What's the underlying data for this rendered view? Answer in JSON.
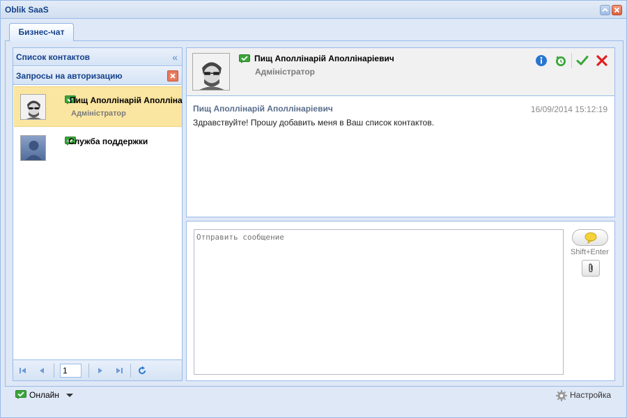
{
  "window": {
    "title": "Oblik SaaS"
  },
  "tabs": [
    {
      "label": "Бизнес-чат"
    }
  ],
  "sidebar": {
    "contacts_header": "Список контактов",
    "requests_header": "Запросы на авторизацию",
    "contacts": [
      {
        "name": "Пищ Аполлінарій Аполлінаріевич",
        "role": "Адміністратор",
        "selected": true
      },
      {
        "name": "Служба поддержки",
        "role": "",
        "selected": false
      }
    ],
    "pager": {
      "page": "1"
    }
  },
  "chat": {
    "header": {
      "name": "Пищ Аполлінарій Аполлінаріевич",
      "role": "Адміністратор"
    },
    "messages": [
      {
        "sender": "Пищ Аполлінарій Аполлінаріевич",
        "time": "16/09/2014 15:12:19",
        "text": "Здравствуйте! Прошу добавить меня в Ваш список контактов."
      }
    ],
    "composer": {
      "placeholder": "Отправить сообщение",
      "send_hint": "Shift+Enter"
    }
  },
  "footer": {
    "status_label": "Онлайн",
    "settings_label": "Настройка"
  },
  "colors": {
    "accent": "#15428b",
    "border": "#99bbe8",
    "selected_row": "#fbe6a1",
    "online": "#3aa63a",
    "reject": "#e02020"
  }
}
